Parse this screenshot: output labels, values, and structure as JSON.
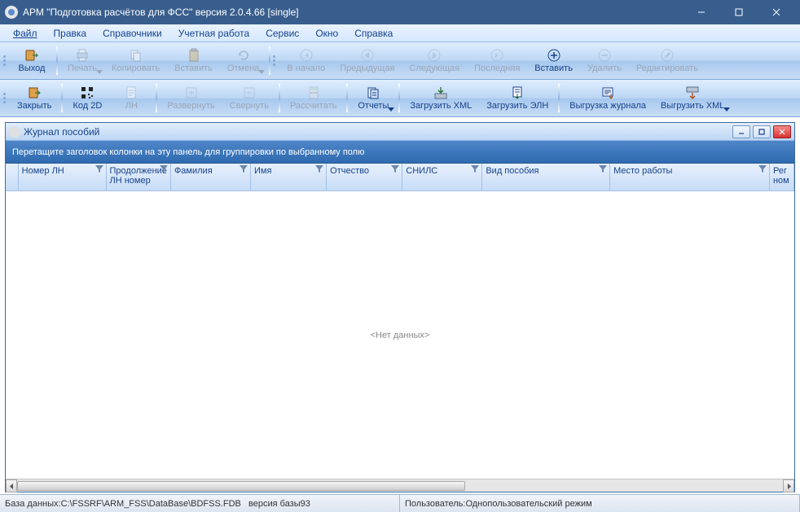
{
  "title": "АРМ \"Подготовка расчётов для ФСС\"   версия 2.0.4.66 [single]",
  "menu": {
    "file": "Файл",
    "edit": "Правка",
    "refs": "Справочники",
    "acct": "Учетная работа",
    "service": "Сервис",
    "window": "Окно",
    "help": "Справка"
  },
  "toolbar1": {
    "exit": "Выход",
    "print": "Печать",
    "copy": "Копировать",
    "paste": "Вставить",
    "undo": "Отмена",
    "first": "В начало",
    "prev": "Предыдущая",
    "next": "Следующая",
    "last": "Последняя",
    "insert": "Вставить",
    "delete": "Удалить",
    "edit_rec": "Редактировать"
  },
  "toolbar2": {
    "close": "Закрыть",
    "code2d": "Код 2D",
    "ln": "ЛН",
    "expand": "Развернуть",
    "collapse": "Свернуть",
    "calc": "Рассчитать",
    "reports": "Отчеты",
    "load_xml": "Загрузить XML",
    "load_eln": "Загрузить ЭЛН",
    "export_journal": "Выгрузка журнала",
    "export_xml": "Выгрузить XML"
  },
  "child": {
    "title": "Журнал пособий",
    "group_hint": "Перетащите заголовок колонки на эту панель для группировки по выбранному полю",
    "columns": {
      "c0": "Номер ЛН",
      "c1": "Продолжение ЛН номер",
      "c2": "Фамилия",
      "c3": "Имя",
      "c4": "Отчество",
      "c5": "СНИЛС",
      "c6": "Вид пособия",
      "c7": "Место работы",
      "c8": "Рег ном"
    },
    "nodata": "<Нет данных>"
  },
  "status": {
    "db_label": "База данных: ",
    "db_path": "C:\\FSSRF\\ARM_FSS\\DataBase\\BDFSS.FDB",
    "db_ver_label": "версия базы ",
    "db_ver": "93",
    "user_label": "Пользователь: ",
    "user": "Однопользовательский режим"
  }
}
